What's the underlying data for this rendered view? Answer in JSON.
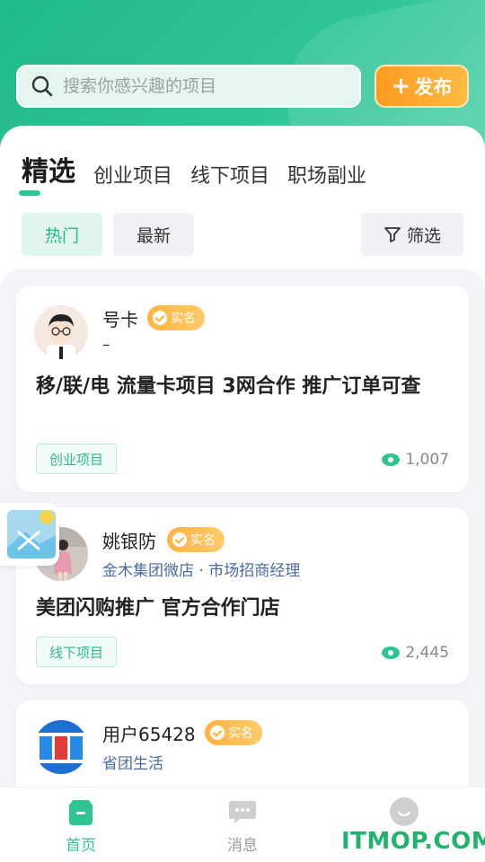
{
  "search": {
    "placeholder": "搜索你感兴趣的项目"
  },
  "publish": {
    "label": "发布",
    "icon": "plus-icon"
  },
  "tabs": [
    {
      "label": "精选"
    },
    {
      "label": "创业项目"
    },
    {
      "label": "线下项目"
    },
    {
      "label": "职场副业"
    }
  ],
  "filters": {
    "hot": "热门",
    "latest": "最新",
    "filter": "筛选"
  },
  "cards": [
    {
      "user": "号卡",
      "badge": "实名",
      "subtitle": "–",
      "title": "移/联/电 流量卡项目 3网合作 推广订单可查",
      "tag": "创业项目",
      "views": "1,007"
    },
    {
      "user": "姚银防",
      "badge": "实名",
      "subtitle": "金木集团微店 · 市场招商经理",
      "title": "美团闪购推广 官方合作门店",
      "tag": "线下项目",
      "views": "2,445"
    },
    {
      "user": "用户65428",
      "badge": "实名",
      "subtitle": "省团生活"
    }
  ],
  "nav": [
    {
      "label": "首页",
      "icon": "home-icon"
    },
    {
      "label": "消息",
      "icon": "chat-icon"
    },
    {
      "label": "",
      "icon": "profile-icon"
    }
  ],
  "watermark": "ITMOP.COM",
  "colors": {
    "accent": "#2ec592",
    "publish": "#ff9b1f",
    "badge": "#ffb33f"
  }
}
